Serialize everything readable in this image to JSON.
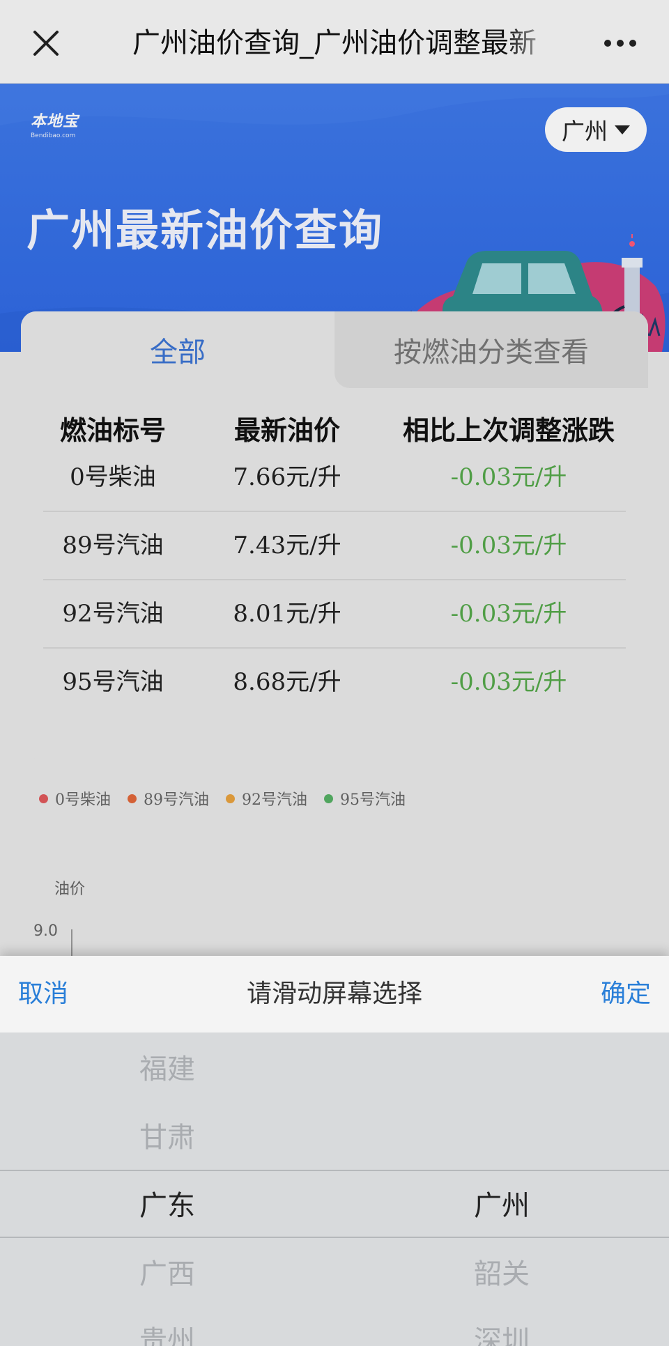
{
  "topbar": {
    "title": "广州油价查询_广州油价调整最新"
  },
  "banner": {
    "logo_text": "本地宝",
    "logo_sub": "Bendibao.com",
    "city": "广州",
    "title": "广州最新油价查询"
  },
  "tabs": [
    {
      "label": "全部",
      "active": true
    },
    {
      "label": "按燃油分类查看",
      "active": false
    }
  ],
  "table": {
    "headers": [
      "燃油标号",
      "最新油价",
      "相比上次调整涨跌"
    ],
    "rows": [
      {
        "fuel": "0号柴油",
        "price": "7.66元/升",
        "change": "-0.03元/升"
      },
      {
        "fuel": "89号汽油",
        "price": "7.43元/升",
        "change": "-0.03元/升"
      },
      {
        "fuel": "92号汽油",
        "price": "8.01元/升",
        "change": "-0.03元/升"
      },
      {
        "fuel": "95号汽油",
        "price": "8.68元/升",
        "change": "-0.03元/升"
      }
    ],
    "change_color": "#55a84b"
  },
  "chart_data": {
    "type": "line",
    "series": [
      {
        "name": "0号柴油",
        "color": "#e0595b"
      },
      {
        "name": "89号汽油",
        "color": "#e2683a"
      },
      {
        "name": "92号汽油",
        "color": "#e8a23e"
      },
      {
        "name": "95号汽油",
        "color": "#56b064"
      }
    ],
    "ylabel": "油价",
    "yticks": [
      "9.0"
    ]
  },
  "picker": {
    "cancel": "取消",
    "title": "请滑动屏幕选择",
    "confirm": "确定",
    "provinces": [
      "福建",
      "甘肃",
      "广东",
      "广西",
      "贵州"
    ],
    "cities": [
      "广州",
      "韶关",
      "深圳"
    ],
    "selected_province": "广东",
    "selected_city": "广州"
  },
  "colors": {
    "accent": "#3b73d3",
    "banner": "#2f69e4",
    "link": "#2a7fd8"
  }
}
